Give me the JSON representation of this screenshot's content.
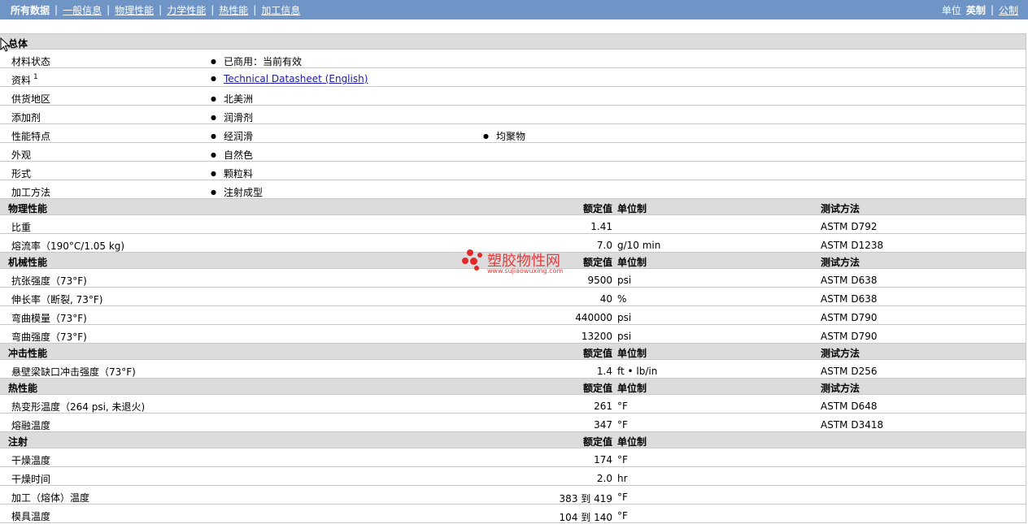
{
  "nav": {
    "items": [
      "所有数据",
      "一般信息",
      "物理性能",
      "力学性能",
      "热性能",
      "加工信息"
    ],
    "units_label": "单位",
    "unit_options": [
      "英制",
      "公制"
    ]
  },
  "general": {
    "title": "总体",
    "rows": [
      {
        "label": "材料状态",
        "values": [
          "已商用：当前有效"
        ]
      },
      {
        "label": "资料",
        "sup": "1",
        "link": "Technical Datasheet (English)"
      },
      {
        "label": "供货地区",
        "values": [
          "北美洲"
        ]
      },
      {
        "label": "添加剂",
        "values": [
          "润滑剂"
        ]
      },
      {
        "label": "性能特点",
        "values": [
          "经润滑",
          "均聚物"
        ]
      },
      {
        "label": "外观",
        "values": [
          "自然色"
        ]
      },
      {
        "label": "形式",
        "values": [
          "颗粒料"
        ]
      },
      {
        "label": "加工方法",
        "values": [
          "注射成型"
        ]
      }
    ]
  },
  "headers": {
    "value": "额定值",
    "unit": "单位制",
    "test": "测试方法"
  },
  "sections": [
    {
      "title": "物理性能",
      "test_header": true,
      "rows": [
        {
          "label": "比重",
          "value": "1.41",
          "unit": "",
          "test": "ASTM D792"
        },
        {
          "label": "熔流率（190°C/1.05 kg)",
          "value": "7.0",
          "unit": "g/10 min",
          "test": "ASTM D1238"
        }
      ]
    },
    {
      "title": "机械性能",
      "test_header": true,
      "rows": [
        {
          "label": "抗张强度（73°F)",
          "value": "9500",
          "unit": "psi",
          "test": "ASTM D638"
        },
        {
          "label": "伸长率（断裂, 73°F)",
          "value": "40",
          "unit": "%",
          "test": "ASTM D638"
        },
        {
          "label": "弯曲模量（73°F)",
          "value": "440000",
          "unit": "psi",
          "test": "ASTM D790"
        },
        {
          "label": "弯曲强度（73°F)",
          "value": "13200",
          "unit": "psi",
          "test": "ASTM D790"
        }
      ]
    },
    {
      "title": "冲击性能",
      "test_header": true,
      "rows": [
        {
          "label": "悬壁梁缺口冲击强度（73°F)",
          "value": "1.4",
          "unit": "ft • lb/in",
          "test": "ASTM D256"
        }
      ]
    },
    {
      "title": "热性能",
      "test_header": true,
      "rows": [
        {
          "label": "热变形温度（264 psi, 未退火)",
          "value": "261",
          "unit": "°F",
          "test": "ASTM D648"
        },
        {
          "label": "熔融温度",
          "value": "347",
          "unit": "°F",
          "test": "ASTM D3418"
        }
      ]
    },
    {
      "title": "注射",
      "test_header": false,
      "rows": [
        {
          "label": "干燥温度",
          "value": "174",
          "unit": "°F",
          "test": ""
        },
        {
          "label": "干燥时间",
          "value": "2.0",
          "unit": "hr",
          "test": ""
        },
        {
          "label": "加工（熔体）温度",
          "value": "383 到  419",
          "unit": "°F",
          "test": ""
        },
        {
          "label": "模具温度",
          "value": "104 到  140",
          "unit": "°F",
          "test": ""
        }
      ]
    }
  ],
  "watermark": {
    "text": "塑胶物性网",
    "url": "www.sujiaowuxing.com"
  }
}
